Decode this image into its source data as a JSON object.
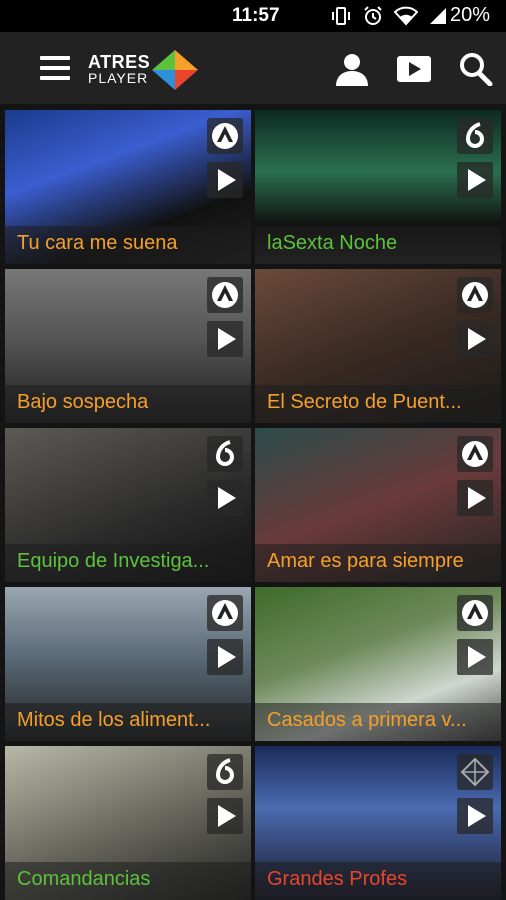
{
  "status": {
    "time": "11:57",
    "battery": "20%"
  },
  "appbar": {
    "logo_line1": "ATRES",
    "logo_line2": "PLAYER"
  },
  "colors": {
    "orange": "#f5a02a",
    "green": "#5cc23b",
    "red": "#e8452c"
  },
  "cards": [
    {
      "title": "Tu cara me suena",
      "channel": "antena3",
      "color": "#f5a02a"
    },
    {
      "title": "laSexta Noche",
      "channel": "lasexta",
      "color": "#5cc23b"
    },
    {
      "title": "Bajo sospecha",
      "channel": "antena3",
      "color": "#f5a02a"
    },
    {
      "title": "El Secreto de Puent...",
      "channel": "antena3",
      "color": "#f5a02a"
    },
    {
      "title": "Equipo de Investiga...",
      "channel": "lasexta",
      "color": "#5cc23b"
    },
    {
      "title": "Amar es para siempre",
      "channel": "antena3",
      "color": "#f5a02a"
    },
    {
      "title": "Mitos de los aliment...",
      "channel": "antena3",
      "color": "#f5a02a"
    },
    {
      "title": "Casados a primera v...",
      "channel": "antena3",
      "color": "#f5a02a"
    },
    {
      "title": "Comandancias",
      "channel": "lasexta",
      "color": "#5cc23b"
    },
    {
      "title": "Grandes Profes",
      "channel": "atresplayer",
      "color": "#e8452c"
    }
  ]
}
